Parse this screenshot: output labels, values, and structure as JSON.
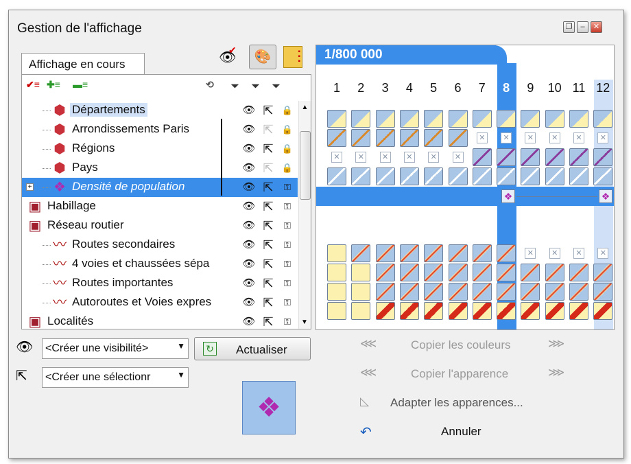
{
  "window": {
    "title": "Gestion de l'affichage",
    "controls": [
      "restore-icon",
      "minimize-icon",
      "close-icon"
    ]
  },
  "toolbar_top": {
    "icons": [
      "eye-check-icon",
      "color-palette-icon",
      "legend-book-icon"
    ]
  },
  "tab": {
    "label": "Affichage en cours"
  },
  "tree_toolbar": {
    "icons": [
      "check-list-icon",
      "add-layer-icon",
      "collapse-icon",
      "visibility-filter-icon",
      "filter-icon",
      "filter-icon",
      "filter-icon"
    ]
  },
  "tree": {
    "items": [
      {
        "label": "Départements",
        "icon": "polygon-layer-icon",
        "level": 1,
        "selected": true
      },
      {
        "label": "Arrondissements Paris",
        "icon": "polygon-layer-icon",
        "level": 1
      },
      {
        "label": "Régions",
        "icon": "polygon-layer-icon",
        "level": 1
      },
      {
        "label": "Pays",
        "icon": "polygon-layer-icon",
        "level": 1
      },
      {
        "label": "Densité de population",
        "icon": "thematic-layer-icon",
        "level": 1,
        "selected": true
      },
      {
        "label": "Habillage",
        "icon": "layer-group-icon",
        "level": 0
      },
      {
        "label": "Réseau routier",
        "icon": "layer-group-icon",
        "level": 0
      },
      {
        "label": "Routes secondaires",
        "icon": "line-layer-icon",
        "level": 1
      },
      {
        "label": "4 voies et chaussées sépa",
        "icon": "line-layer-icon",
        "level": 1
      },
      {
        "label": "Routes importantes",
        "icon": "line-layer-icon",
        "level": 1
      },
      {
        "label": "Autoroutes et Voies expres",
        "icon": "line-layer-icon",
        "level": 1
      },
      {
        "label": "Localités",
        "icon": "layer-group-icon",
        "level": 0
      }
    ]
  },
  "scale": {
    "label": "1/800 000",
    "selected_column": "8"
  },
  "columns": [
    "1",
    "2",
    "3",
    "4",
    "5",
    "6",
    "7",
    "8",
    "9",
    "10",
    "11",
    "12"
  ],
  "visibility": {
    "combo": "<Créer une visibilité>",
    "refresh_label": "Actualiser"
  },
  "selection": {
    "combo": "<Créer une sélectionr"
  },
  "actions": {
    "copy_colors": "Copier les couleurs",
    "copy_appearance": "Copier l'apparence",
    "adapt": "Adapter les apparences...",
    "cancel": "Annuler"
  },
  "colors": {
    "accent": "#3a8de8",
    "selection": "#cfe0f7",
    "cell": "#a9c6e6"
  }
}
